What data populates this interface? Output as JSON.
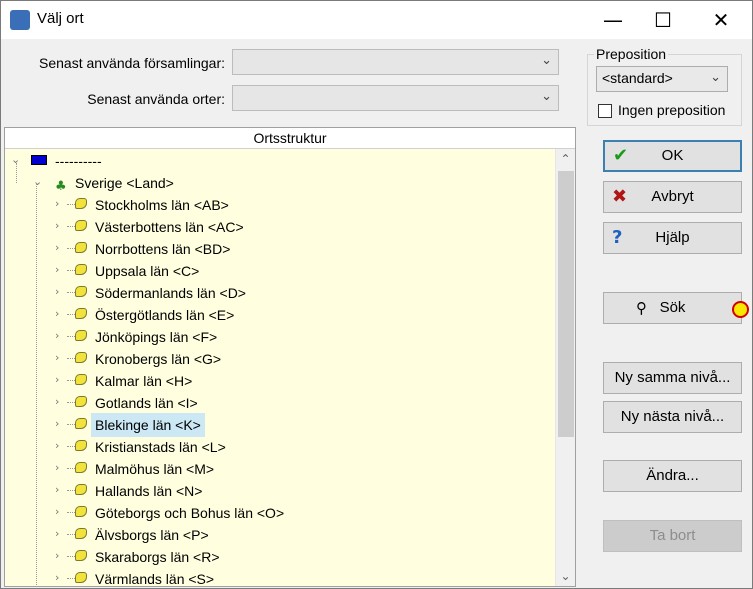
{
  "window": {
    "title": "Välj ort"
  },
  "titlebar_controls": {
    "minimize": "—",
    "maximize": "☐",
    "close": "✕"
  },
  "fields": {
    "recent_parishes_label": "Senast använda församlingar:",
    "recent_parishes_value": "",
    "recent_places_label": "Senast använda orter:",
    "recent_places_value": ""
  },
  "preposition": {
    "group_title": "Preposition",
    "selected": "<standard>",
    "no_preposition_label": "Ingen preposition",
    "no_preposition_checked": false
  },
  "tree": {
    "header": "Ortsstruktur",
    "root_label": "----------",
    "country_label": "Sverige <Land>",
    "selected_label": "Blekinge län <K>",
    "counties": [
      "Stockholms län <AB>",
      "Västerbottens län <AC>",
      "Norrbottens län <BD>",
      "Uppsala län <C>",
      "Södermanlands län <D>",
      "Östergötlands län <E>",
      "Jönköpings län <F>",
      "Kronobergs län <G>",
      "Kalmar län <H>",
      "Gotlands län <I>",
      "Blekinge län <K>",
      "Kristianstads län <L>",
      "Malmöhus län <M>",
      "Hallands län <N>",
      "Göteborgs och Bohus län <O>",
      "Älvsborgs län <P>",
      "Skaraborgs län <R>",
      "Värmlands län <S>"
    ]
  },
  "buttons": {
    "ok": "OK",
    "cancel": "Avbryt",
    "help": "Hjälp",
    "search": "Sök",
    "new_same_level": "Ny samma nivå...",
    "new_next_level": "Ny nästa nivå...",
    "edit": "Ändra...",
    "delete": "Ta bort"
  },
  "colors": {
    "selection": "#cce8f4",
    "tree_background": "#ffffe0",
    "default_border": "#3c7fb1"
  }
}
